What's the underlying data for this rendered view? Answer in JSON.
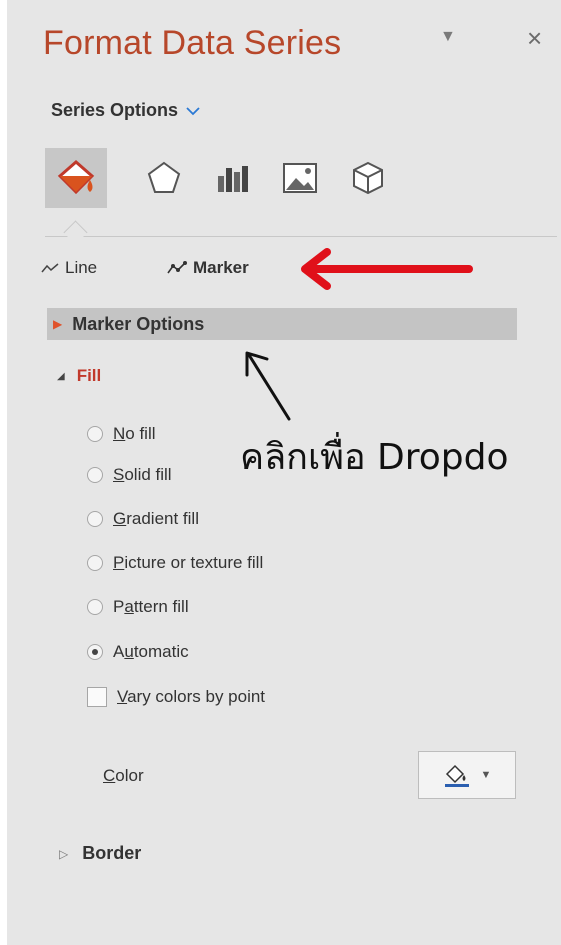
{
  "panel": {
    "title": "Format Data Series",
    "dropdown_glyph": "▼",
    "close_glyph": "×"
  },
  "series_options": {
    "label": "Series Options"
  },
  "category_tabs": [
    {
      "icon": "fill-bucket-icon",
      "active": true
    },
    {
      "icon": "pentagon-effects-icon",
      "active": false
    },
    {
      "icon": "bar-chart-icon",
      "active": false
    },
    {
      "icon": "picture-icon",
      "active": false
    },
    {
      "icon": "cube-3d-icon",
      "active": false
    }
  ],
  "sub_tabs": {
    "line": "Line",
    "marker": "Marker"
  },
  "marker_options": {
    "label": "Marker Options"
  },
  "fill": {
    "label": "Fill",
    "options": [
      {
        "pre": "",
        "key": "N",
        "post": "o fill",
        "selected": false
      },
      {
        "pre": "",
        "key": "S",
        "post": "olid fill",
        "selected": false
      },
      {
        "pre": "",
        "key": "G",
        "post": "radient fill",
        "selected": false
      },
      {
        "pre": "",
        "key": "P",
        "post": "icture or texture fill",
        "selected": false
      },
      {
        "pre": "P",
        "key": "a",
        "post": "ttern fill",
        "selected": false
      },
      {
        "pre": "A",
        "key": "u",
        "post": "tomatic",
        "selected": true
      }
    ],
    "vary_colors": {
      "key": "V",
      "post": "ary colors by point",
      "checked": false
    },
    "color": {
      "key": "C",
      "post": "olor"
    }
  },
  "border": {
    "label": "Border"
  },
  "annotation": {
    "text": "คลิกเพื่อ Dropdo"
  },
  "colors": {
    "title": "#b7472a",
    "accent_red": "#e0101a",
    "chevron": "#2b79d4",
    "fill_label": "#c1392b"
  }
}
